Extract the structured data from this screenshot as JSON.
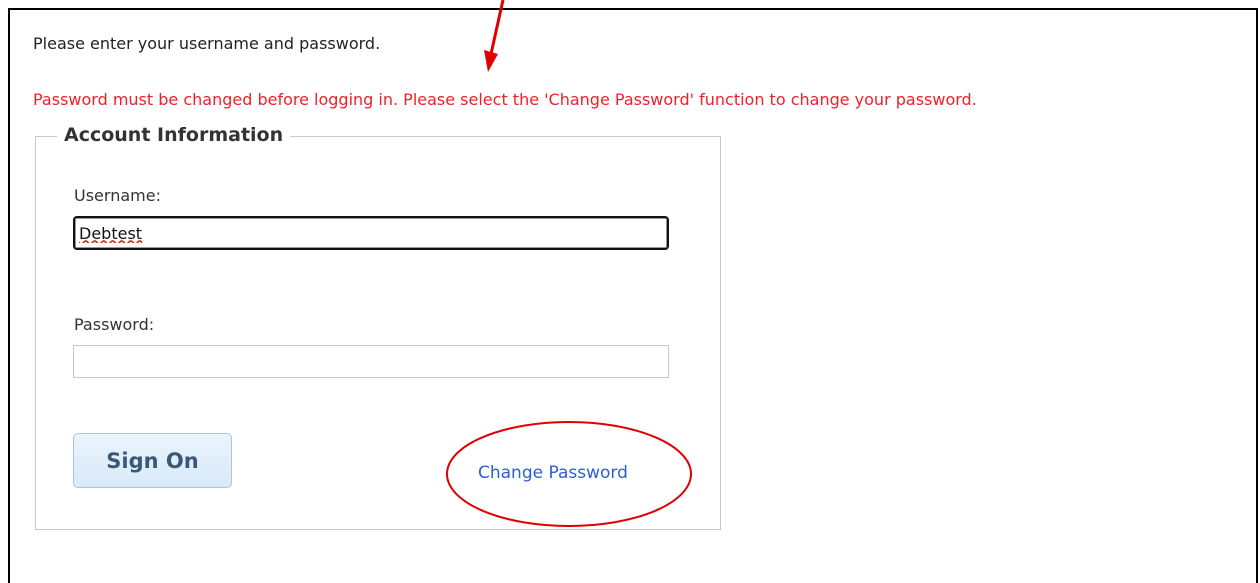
{
  "login": {
    "instruction": "Please enter your username and password.",
    "error": "Password must be changed before logging in. Please select the 'Change Password' function to change your password.",
    "fieldset_title": "Account Information",
    "username_label": "Username:",
    "username_value": "Debtest",
    "password_label": "Password:",
    "password_value": "",
    "sign_on_label": "Sign On",
    "change_password_label": "Change Password"
  },
  "annotations": {
    "color": "#e00000",
    "arrow": "arrow-down-icon",
    "highlight": "ellipse-highlight"
  }
}
